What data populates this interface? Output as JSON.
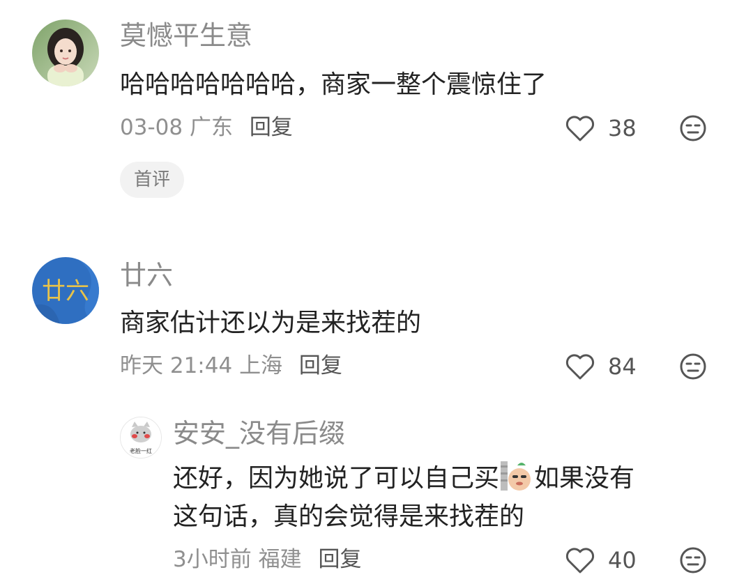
{
  "comments": [
    {
      "username": "莫憾平生意",
      "text": "哈哈哈哈哈哈哈，商家一整个震惊住了",
      "time": "03-08",
      "location": "广东",
      "reply_label": "回复",
      "likes": "38",
      "tag": "首评",
      "avatar_icon": "girl-photo-avatar"
    },
    {
      "username": "廿六",
      "text": "商家估计还以为是来找茬的",
      "time": "昨天 21:44",
      "location": "上海",
      "reply_label": "回复",
      "likes": "84",
      "avatar_icon": "blue-circle-text-avatar",
      "avatar_text": "廿六",
      "replies": [
        {
          "username": "安安_没有后缀",
          "text_before_emoji": "还好，因为她说了可以自己买",
          "emoji": "peeking-sticker-emoji",
          "text_after_emoji": "如果没有",
          "text_line2": "这句话，真的会觉得是来找茬的",
          "time": "3小时前",
          "location": "福建",
          "reply_label": "回复",
          "likes": "40",
          "avatar_icon": "cartoon-cat-avatar",
          "avatar_caption": "老脸一红"
        }
      ]
    }
  ],
  "colors": {
    "username": "#8a8a8a",
    "text": "#222222",
    "meta": "#8f8f8f",
    "tag_bg": "#f2f2f2",
    "avatar2_bg": "#2f6fc1",
    "avatar2_text": "#e8c34a"
  }
}
